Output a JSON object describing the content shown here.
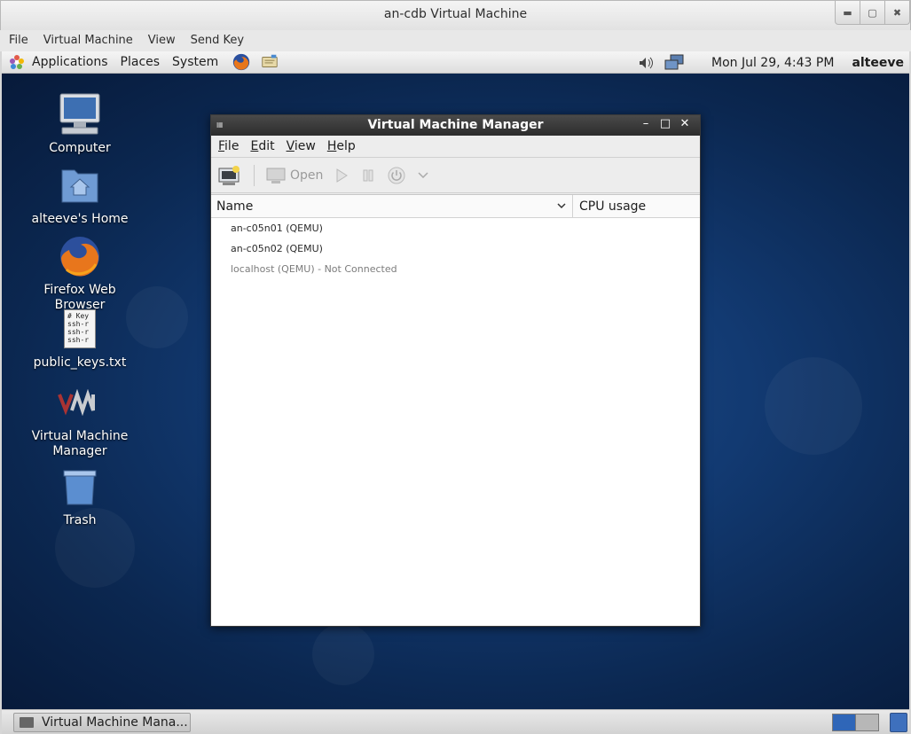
{
  "host": {
    "title": "an-cdb Virtual Machine",
    "menu": [
      "File",
      "Virtual Machine",
      "View",
      "Send Key"
    ],
    "controls": [
      "minimize-icon",
      "maximize-icon",
      "close-icon"
    ]
  },
  "panel": {
    "menus": [
      "Applications",
      "Places",
      "System"
    ],
    "launchers": [
      "firefox-icon",
      "notes-icon"
    ],
    "tray_icons": [
      "volume-icon",
      "network-icon"
    ],
    "clock": "Mon Jul 29,  4:43 PM",
    "user": "alteeve"
  },
  "desktop": {
    "icons": [
      {
        "label": "Computer",
        "icon": "computer-icon"
      },
      {
        "label": "alteeve's Home",
        "icon": "home-folder-icon"
      },
      {
        "label": "Firefox Web Browser",
        "icon": "firefox-icon"
      },
      {
        "label": "public_keys.txt",
        "icon": "text-file-icon",
        "preview": [
          "# Key",
          "ssh-r",
          "ssh-r",
          "ssh-r"
        ]
      },
      {
        "label": "Virtual Machine Manager",
        "icon": "vmm-icon"
      },
      {
        "label": "Trash",
        "icon": "trash-icon"
      }
    ]
  },
  "vmm": {
    "title": "Virtual Machine Manager",
    "menu": {
      "file_label": "File",
      "file_key": "F",
      "file_rest": "ile",
      "edit_label": "Edit",
      "edit_key": "E",
      "edit_rest": "dit",
      "view_label": "View",
      "view_key": "V",
      "view_rest": "iew",
      "help_label": "Help",
      "help_key": "H",
      "help_rest": "elp"
    },
    "toolbar": {
      "open_label": "Open"
    },
    "columns": {
      "name": "Name",
      "cpu": "CPU usage"
    },
    "rows": [
      {
        "label": "an-c05n01 (QEMU)",
        "connected": true
      },
      {
        "label": "an-c05n02 (QEMU)",
        "connected": true
      },
      {
        "label": "localhost (QEMU) - Not Connected",
        "connected": false
      }
    ]
  },
  "taskbar": {
    "task_label": "Virtual Machine Mana...",
    "workspaces": 2,
    "active_workspace": 1
  }
}
